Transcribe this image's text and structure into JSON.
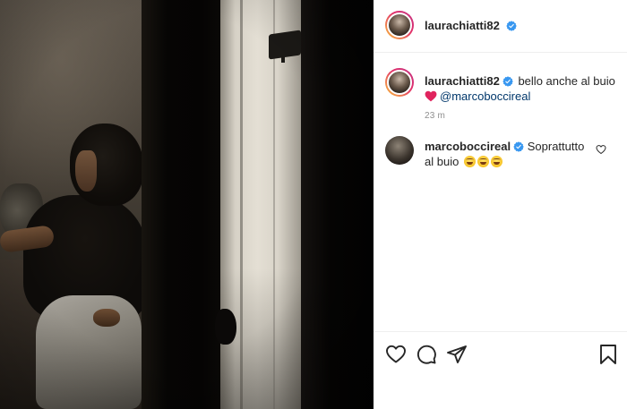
{
  "post": {
    "author": "laurachiatti82",
    "caption_text": "bello anche al buio",
    "mention": "@marcoboccireal",
    "time": "23 m"
  },
  "comments": [
    {
      "user": "marcoboccireal",
      "text": "Soprattutto al buio",
      "emoji": [
        "laughing-tears-emoji",
        "laughing-tears-emoji",
        "laughing-tears-emoji"
      ]
    }
  ],
  "icons": {
    "verified": "verified-badge-icon",
    "like": "heart-icon",
    "comment": "comment-icon",
    "share": "send-icon",
    "save": "bookmark-icon"
  },
  "colors": {
    "verified_blue": "#3897f0",
    "mention_blue": "#00376b",
    "heart_red": "#e0245e",
    "secondary_text": "#8e8e8e"
  }
}
